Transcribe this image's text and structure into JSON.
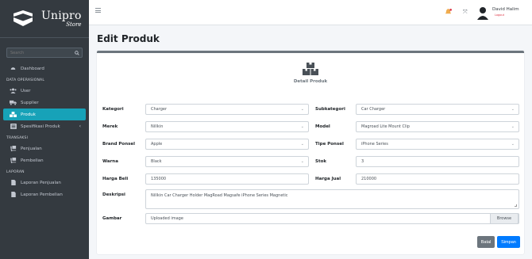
{
  "brand": {
    "name": "Unipro",
    "sub": "Store"
  },
  "sidebar": {
    "search_placeholder": "Search",
    "items": [
      {
        "type": "item",
        "label": "Dashboard",
        "icon": "dashboard-icon"
      },
      {
        "type": "header",
        "label": "DATA OPERASIONAL"
      },
      {
        "type": "item",
        "label": "User",
        "icon": "users-icon"
      },
      {
        "type": "item",
        "label": "Supplier",
        "icon": "truck-icon"
      },
      {
        "type": "item",
        "label": "Produk",
        "icon": "boxes-icon",
        "active": true
      },
      {
        "type": "item",
        "label": "Spesifikasi Produk",
        "icon": "list-icon",
        "chevron": "‹"
      },
      {
        "type": "header",
        "label": "TRANSAKSI"
      },
      {
        "type": "item",
        "label": "Penjualan",
        "icon": "dolly-icon"
      },
      {
        "type": "item",
        "label": "Pembelian",
        "icon": "dolly-icon"
      },
      {
        "type": "header",
        "label": "LAPORAN"
      },
      {
        "type": "item",
        "label": "Laporan Penjualan",
        "icon": "file-icon"
      },
      {
        "type": "item",
        "label": "Laporan Pembelian",
        "icon": "file-icon"
      }
    ]
  },
  "topbar": {
    "user_name": "David Halim",
    "user_status": "Logout"
  },
  "page_title": "Edit Produk",
  "card": {
    "header": "Detail Produk",
    "fields": {
      "kategori": {
        "label": "Kategori",
        "value": "Charger"
      },
      "subkategori": {
        "label": "Subkategori",
        "value": "Car Charger"
      },
      "merek": {
        "label": "Merek",
        "value": "Nillkin"
      },
      "model": {
        "label": "Model",
        "value": "Magroad Lite Mount Clip"
      },
      "brand_ponsel": {
        "label": "Brand Ponsel",
        "value": "Apple"
      },
      "tipe_ponsel": {
        "label": "Tipe Ponsel",
        "value": "iPhone Series"
      },
      "warna": {
        "label": "Warna",
        "value": "Black"
      },
      "stok": {
        "label": "Stok",
        "value": "3"
      },
      "harga_beli": {
        "label": "Harga Beli",
        "value": "135000"
      },
      "harga_jual": {
        "label": "Harga Jual",
        "value": "210000"
      },
      "deskripsi": {
        "label": "Deskripsi",
        "value": "Nillkin Car Charger Holder MagRoad Magsafe iPhone Series Magnetic"
      },
      "gambar": {
        "label": "Gambar",
        "value": "Uploaded image",
        "browse": "Browse"
      }
    },
    "buttons": {
      "cancel": "Batal",
      "save": "Simpan"
    }
  },
  "colors": {
    "sidebar": "#343a40",
    "active": "#17a2b8",
    "primary": "#007bff",
    "secondary": "#6c757d"
  }
}
